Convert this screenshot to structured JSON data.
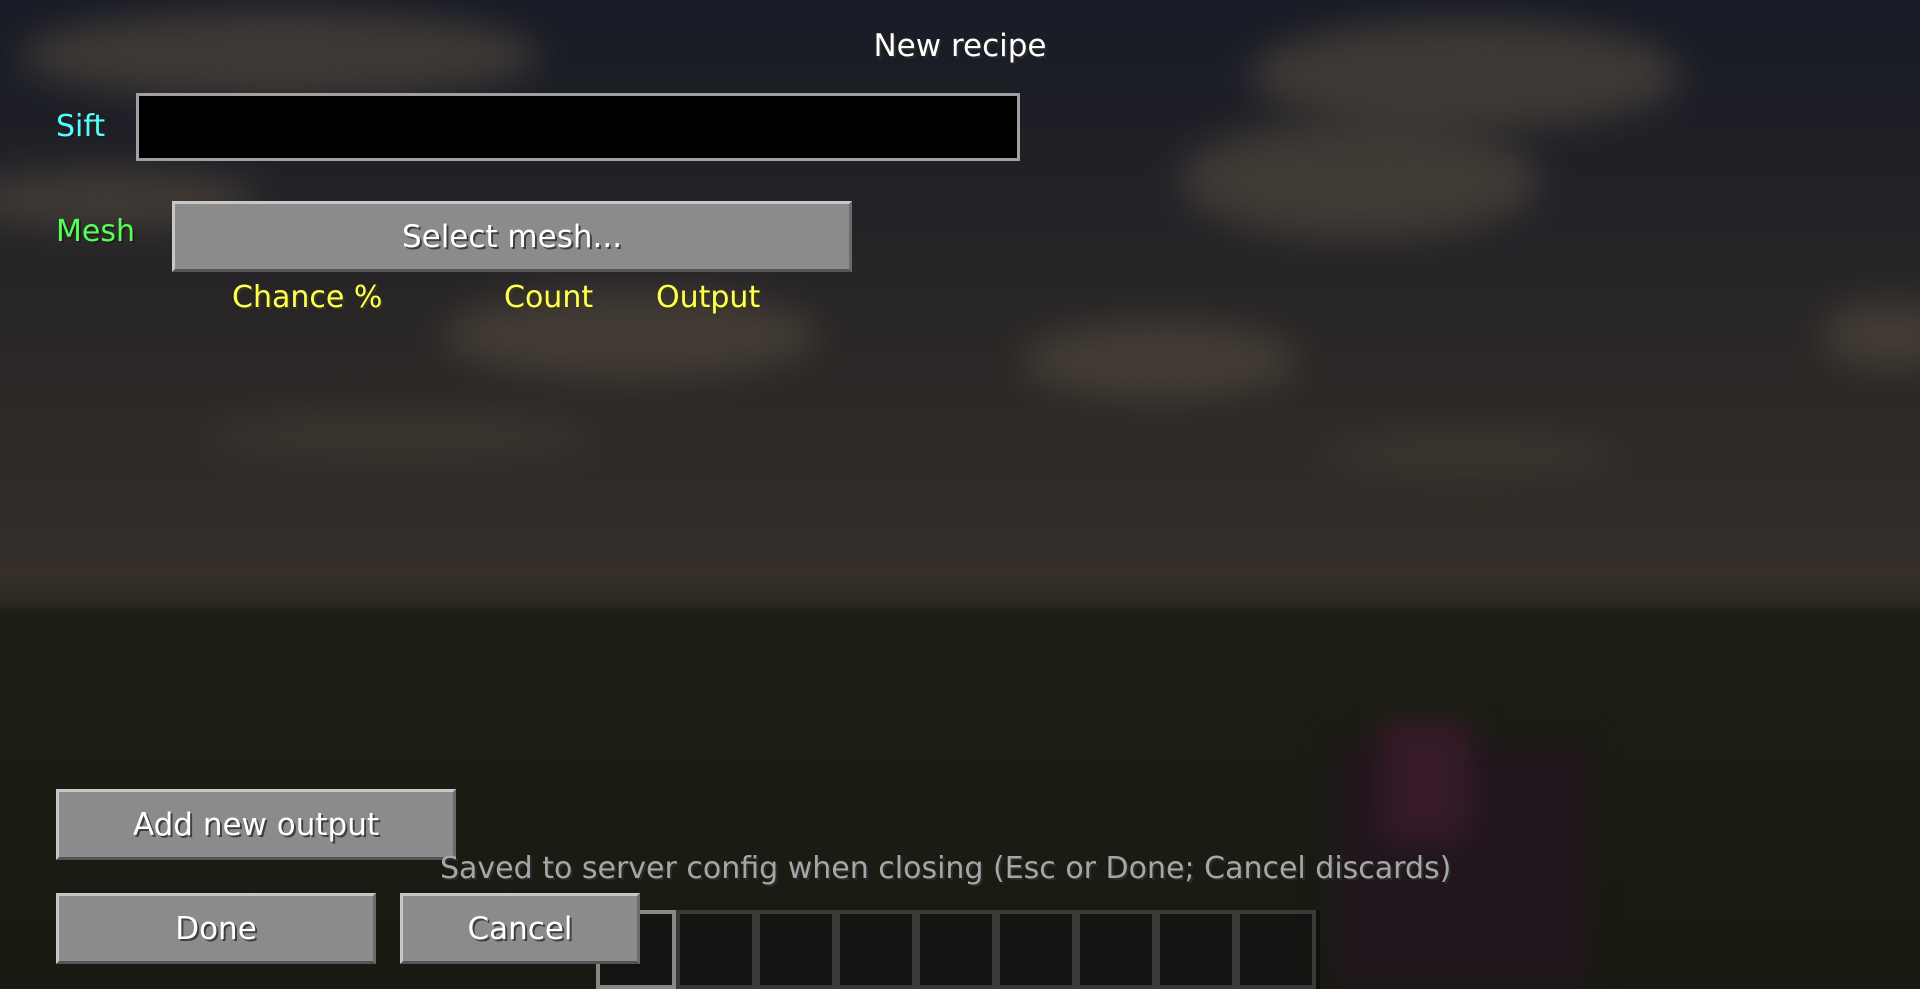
{
  "screen": {
    "title": "New recipe"
  },
  "form": {
    "sift_label": "Sift",
    "sift_value": "",
    "mesh_label": "Mesh",
    "mesh_button_label": "Select mesh..."
  },
  "outputs_table": {
    "columns": [
      "Chance %",
      "Count",
      "Output"
    ]
  },
  "actions": {
    "add_output_label": "Add new output",
    "done_label": "Done",
    "cancel_label": "Cancel"
  },
  "status": {
    "save_note": "Saved to server config when closing (Esc or Done; Cancel discards)"
  },
  "hotbar": {
    "slot_count": 9,
    "selected_slot": 1
  },
  "colors": {
    "sift_label": "#55ffff",
    "mesh_label": "#55ff55",
    "column_header": "#ffff55",
    "note_text": "#a6a6a6",
    "button_face": "#8b8b8b"
  }
}
